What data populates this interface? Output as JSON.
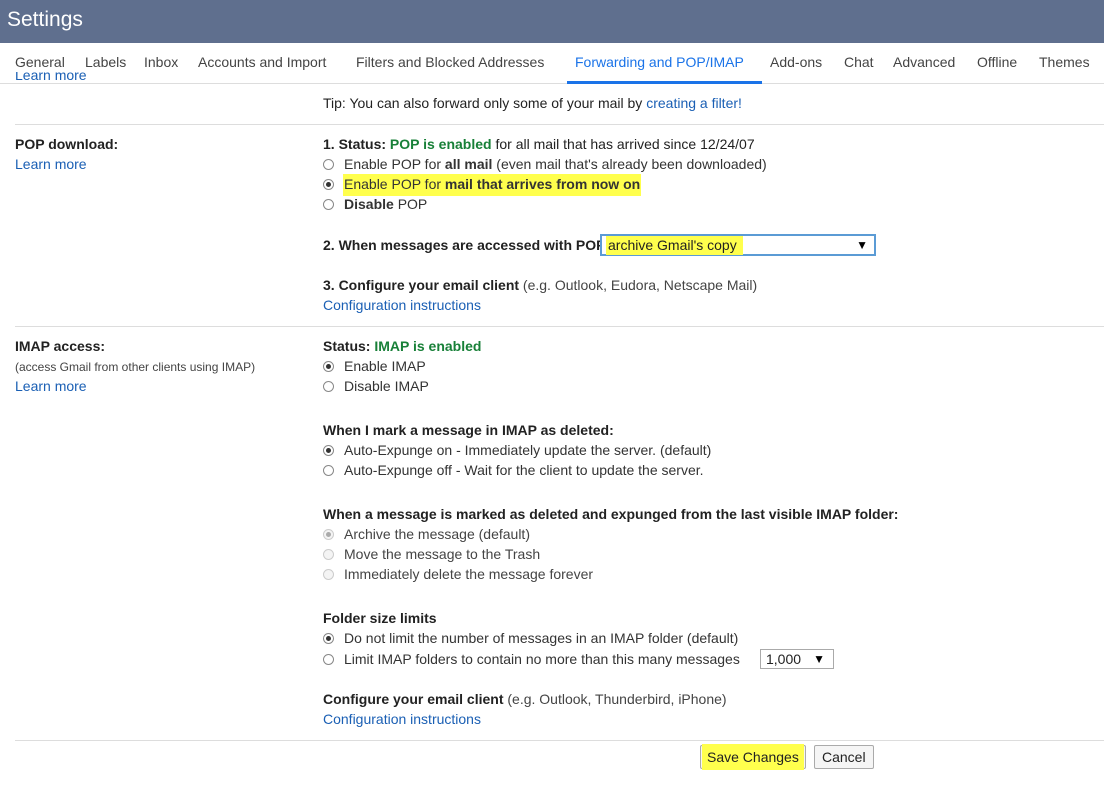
{
  "header": {
    "title": "Settings"
  },
  "tabs": [
    {
      "label": "General"
    },
    {
      "label": "Labels"
    },
    {
      "label": "Inbox"
    },
    {
      "label": "Accounts and Import"
    },
    {
      "label": "Filters and Blocked Addresses"
    },
    {
      "label": "Forwarding and POP/IMAP",
      "active": true
    },
    {
      "label": "Add-ons"
    },
    {
      "label": "Chat"
    },
    {
      "label": "Advanced"
    },
    {
      "label": "Offline"
    },
    {
      "label": "Themes"
    }
  ],
  "forwarding": {
    "learn_more": "Learn more",
    "tip_prefix": "Tip: You can also forward only some of your mail by ",
    "tip_link": "creating a filter!"
  },
  "pop": {
    "label": "POP download:",
    "learn_more": "Learn more",
    "status_label": "1. Status: ",
    "status_value": "POP is enabled",
    "status_suffix": " for all mail that has arrived since 12/24/07",
    "options": [
      {
        "prefix": "Enable POP for ",
        "bold": "all mail",
        "suffix": " (even mail that's already been downloaded)",
        "checked": false
      },
      {
        "prefix": "Enable POP for ",
        "bold": "mail that arrives from now on",
        "suffix": "",
        "checked": true
      },
      {
        "prefix": "",
        "bold": "Disable",
        "suffix": " POP",
        "checked": false
      }
    ],
    "access_label": "2. When messages are accessed with POP",
    "access_value": "archive Gmail's copy",
    "configure_label": "3. Configure your email client",
    "configure_hint": " (e.g. Outlook, Eudora, Netscape Mail)",
    "configure_link": "Configuration instructions"
  },
  "imap": {
    "label": "IMAP access:",
    "sublabel": "(access Gmail from other clients using IMAP)",
    "learn_more": "Learn more",
    "status_label": "Status: ",
    "status_value": "IMAP is enabled",
    "options": [
      {
        "label": "Enable IMAP",
        "checked": true
      },
      {
        "label": "Disable IMAP",
        "checked": false
      }
    ],
    "deleted_label": "When I mark a message in IMAP as deleted:",
    "deleted_options": [
      {
        "label": "Auto-Expunge on - Immediately update the server. (default)",
        "checked": true
      },
      {
        "label": "Auto-Expunge off - Wait for the client to update the server.",
        "checked": false
      }
    ],
    "expunged_label": "When a message is marked as deleted and expunged from the last visible IMAP folder:",
    "expunged_options": [
      {
        "label": "Archive the message (default)",
        "checked": true
      },
      {
        "label": "Move the message to the Trash",
        "checked": false
      },
      {
        "label": "Immediately delete the message forever",
        "checked": false
      }
    ],
    "folder_label": "Folder size limits",
    "folder_options": [
      {
        "label": "Do not limit the number of messages in an IMAP folder (default)",
        "checked": true
      },
      {
        "label": "Limit IMAP folders to contain no more than this many messages",
        "checked": false
      }
    ],
    "folder_limit_value": "1,000",
    "configure_label": "Configure your email client",
    "configure_hint": " (e.g. Outlook, Thunderbird, iPhone)",
    "configure_link": "Configuration instructions"
  },
  "footer": {
    "save": "Save Changes",
    "cancel": "Cancel"
  },
  "icons": {
    "dropdown_arrow": "▼"
  },
  "colors": {
    "header_bg": "#5f6f8e",
    "accent": "#1a73e8",
    "enabled_green": "#188038",
    "highlight": "#ffff4d"
  }
}
